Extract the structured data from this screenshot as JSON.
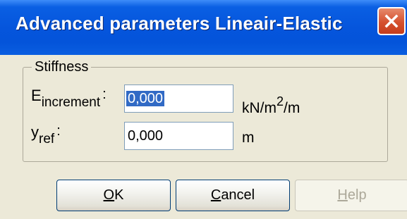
{
  "window": {
    "title": "Advanced parameters Lineair-Elastic",
    "close_icon": "close-icon"
  },
  "stiffness": {
    "group_label": "Stiffness",
    "e_increment": {
      "label_main": "E",
      "label_sub": "increment",
      "colon": ":",
      "value": "0,000",
      "unit_prefix": "kN/m",
      "unit_power": "2",
      "unit_suffix": "/m"
    },
    "y_ref": {
      "label_main": "y",
      "label_sub": "ref",
      "colon": ":",
      "value": "0,000",
      "unit": "m"
    }
  },
  "buttons": {
    "ok": {
      "mnemonic": "O",
      "rest": "K"
    },
    "cancel": {
      "mnemonic": "C",
      "rest": "ancel"
    },
    "help": {
      "mnemonic": "H",
      "rest": "elp",
      "enabled": false
    }
  },
  "colors": {
    "titlebar": "#0555dc",
    "dialog_background": "#ece9d8",
    "selection": "#316ac5",
    "close_button": "#d5502e"
  }
}
